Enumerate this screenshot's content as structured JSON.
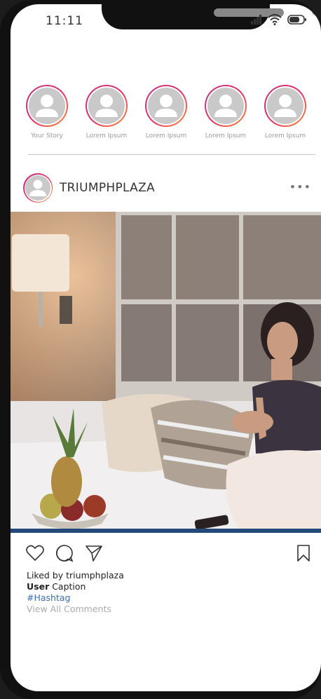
{
  "status_bar": {
    "time": "11:11"
  },
  "stories": [
    {
      "label": "Your Story"
    },
    {
      "label": "Lorem Ipsum"
    },
    {
      "label": "Lorem Ipsum"
    },
    {
      "label": "Lorem Ipsum"
    },
    {
      "label": "Lorem Ipsum"
    }
  ],
  "post": {
    "username": "TRIUMPHPLAZA",
    "more": "•••",
    "liked_by": "Liked by triumphplaza",
    "caption_user": "User",
    "caption_text": " Caption",
    "hashtag": "#Hashtag",
    "view_comments": "View All Comments"
  },
  "colors": {
    "story_ring_gradient": [
      "#c13584",
      "#e1306c",
      "#fd8d32"
    ],
    "hashtag": "#3b6ea5"
  },
  "icons": [
    "signal-icon",
    "wifi-icon",
    "battery-icon",
    "heart-icon",
    "comment-icon",
    "share-icon",
    "bookmark-icon",
    "more-icon"
  ]
}
